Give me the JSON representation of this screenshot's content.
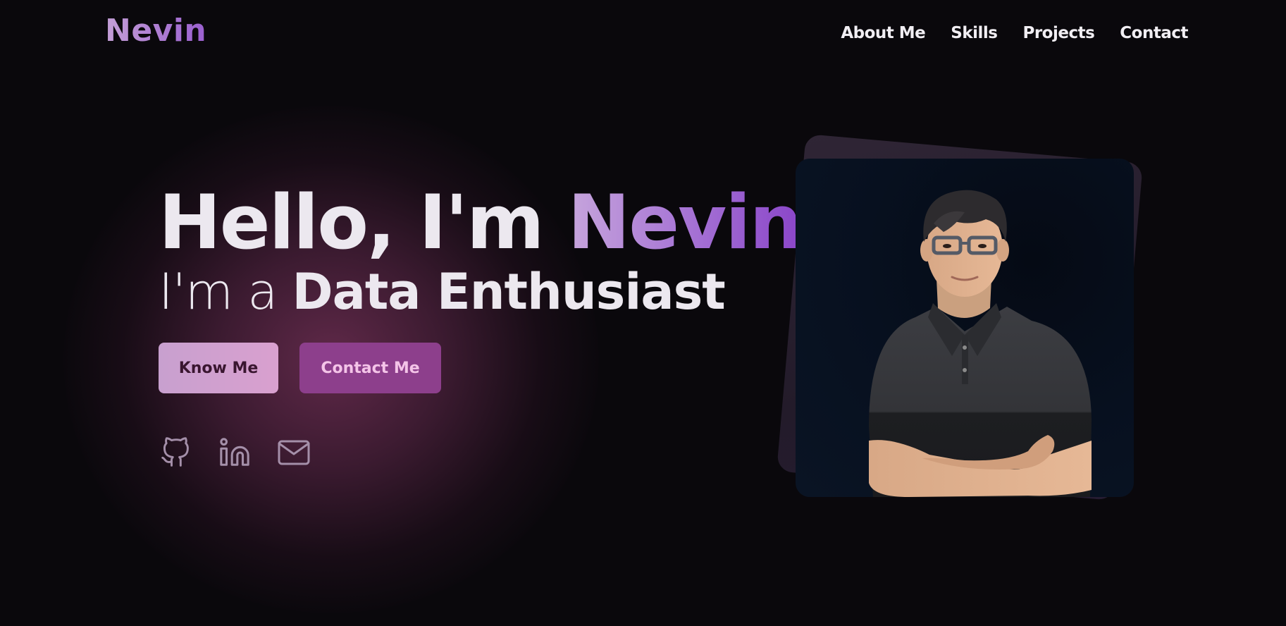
{
  "nav": {
    "brand": "Nevin",
    "links": [
      "About Me",
      "Skills",
      "Projects",
      "Contact"
    ]
  },
  "hero": {
    "greeting": "Hello, I'm ",
    "name": "Nevin",
    "role_prefix": "I'm a ",
    "role": "Data Enthusiast",
    "primary_button": "Know Me",
    "secondary_button": "Contact Me",
    "social_icons": [
      "github-icon",
      "linkedin-icon",
      "mail-icon"
    ]
  },
  "colors": {
    "background": "#0a080c",
    "accent_purple": "#9a5fd0",
    "button_light": "#d9a0cf",
    "button_dark": "#8d3f8c"
  }
}
